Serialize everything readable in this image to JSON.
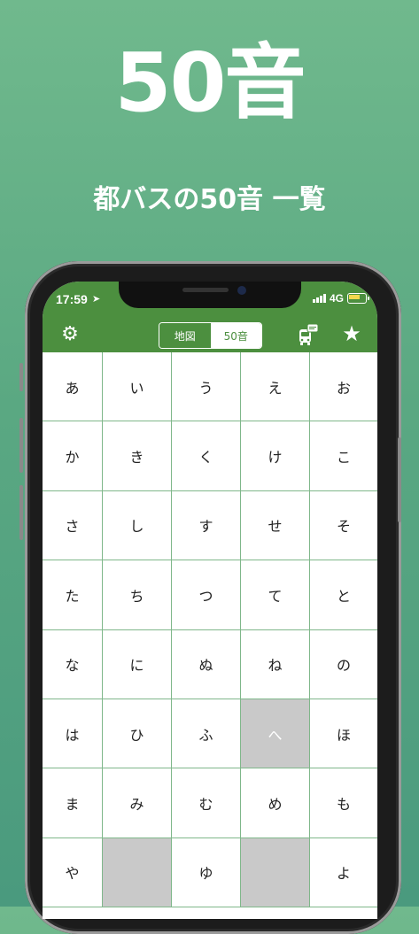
{
  "headline": "50音",
  "subheadline": "都バスの50音 一覧",
  "status": {
    "time": "17:59",
    "network": "4G"
  },
  "navbar": {
    "tabs": [
      {
        "label": "地図",
        "selected": false
      },
      {
        "label": "50音",
        "selected": true
      }
    ],
    "left_icon": "gear-icon",
    "right_icons": [
      "bus-message-icon",
      "star-icon"
    ]
  },
  "colors": {
    "accent": "#4c8f3f",
    "background_top": "#70b98d",
    "background_bottom": "#4a9a7e",
    "disabled_cell": "#c9c9c9",
    "battery": "#f3d94e"
  },
  "kana_grid": [
    [
      "あ",
      "い",
      "う",
      "え",
      "お"
    ],
    [
      "か",
      "き",
      "く",
      "け",
      "こ"
    ],
    [
      "さ",
      "し",
      "す",
      "せ",
      "そ"
    ],
    [
      "た",
      "ち",
      "つ",
      "て",
      "と"
    ],
    [
      "な",
      "に",
      "ぬ",
      "ね",
      "の"
    ],
    [
      "は",
      "ひ",
      "ふ",
      "へ",
      "ほ"
    ],
    [
      "ま",
      "み",
      "む",
      "め",
      "も"
    ],
    [
      "や",
      "",
      "ゆ",
      "",
      "よ"
    ]
  ],
  "disabled_cells": [
    [
      5,
      3
    ],
    [
      7,
      1
    ],
    [
      7,
      3
    ]
  ]
}
